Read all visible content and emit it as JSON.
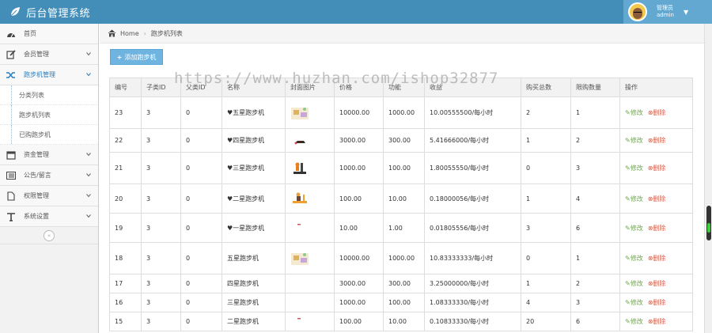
{
  "app": {
    "title": "后台管理系统"
  },
  "user": {
    "role": "管理员",
    "name": "admin"
  },
  "sidebar": {
    "items": [
      {
        "label": "首页",
        "icon": "dashboard-icon"
      },
      {
        "label": "会员管理",
        "icon": "edit-icon"
      },
      {
        "label": "跑步机管理",
        "icon": "shuffle-icon"
      },
      {
        "label": "资金管理",
        "icon": "calendar-icon"
      },
      {
        "label": "公告/留言",
        "icon": "list-icon"
      },
      {
        "label": "权限管理",
        "icon": "file-icon"
      },
      {
        "label": "系统设置",
        "icon": "text-icon"
      }
    ],
    "sub_items": [
      "分类列表",
      "跑步机列表",
      "已购跑步机"
    ],
    "collapse_glyph": "«"
  },
  "breadcrumb": {
    "home": "Home",
    "current": "跑步机列表"
  },
  "toolbar": {
    "add_label": "添加跑步机"
  },
  "watermark": "https://www.huzhan.com/ishop32877",
  "table": {
    "columns": [
      "编号",
      "子类ID",
      "父类ID",
      "名称",
      "封面图片",
      "价格",
      "功能",
      "收益",
      "购买总数",
      "限购数量",
      "操作"
    ],
    "rows": [
      [
        "23",
        "3",
        "0",
        "♥五星跑步机",
        "thumb-a",
        "10000.00",
        "1000.00",
        "10.00555500/每小时",
        "2",
        "1"
      ],
      [
        "22",
        "3",
        "0",
        "♥四星跑步机",
        "thumb-b",
        "3000.00",
        "300.00",
        "5.41666000/每小时",
        "1",
        "2"
      ],
      [
        "21",
        "3",
        "0",
        "♥三星跑步机",
        "thumb-c",
        "1000.00",
        "100.00",
        "1.80055550/每小时",
        "0",
        "3"
      ],
      [
        "20",
        "3",
        "0",
        "♥二星跑步机",
        "thumb-d",
        "100.00",
        "10.00",
        "0.18000056/每小时",
        "1",
        "4"
      ],
      [
        "19",
        "3",
        "0",
        "♥一星跑步机",
        "thumb-e",
        "10.00",
        "1.00",
        "0.01805556/每小时",
        "3",
        "6"
      ],
      [
        "18",
        "3",
        "0",
        "五星跑步机",
        "thumb-a",
        "10000.00",
        "1000.00",
        "10.83333333/每小时",
        "0",
        "1"
      ],
      [
        "17",
        "3",
        "0",
        "四星跑步机",
        "",
        "3000.00",
        "300.00",
        "3.25000000/每小时",
        "1",
        "2"
      ],
      [
        "16",
        "3",
        "0",
        "三星跑步机",
        "",
        "1000.00",
        "100.00",
        "1.08333330/每小时",
        "4",
        "3"
      ],
      [
        "15",
        "3",
        "0",
        "二星跑步机",
        "thumb-e",
        "100.00",
        "10.00",
        "0.10833330/每小时",
        "20",
        "6"
      ]
    ],
    "edit_label": "✎修改",
    "delete_label": "⊗删除"
  },
  "colors": {
    "navbar": "#438eb9",
    "user_box": "#62a8d1",
    "add_button": "#6fb3e0",
    "edit": "#69aa46",
    "delete": "#dd5a43"
  }
}
